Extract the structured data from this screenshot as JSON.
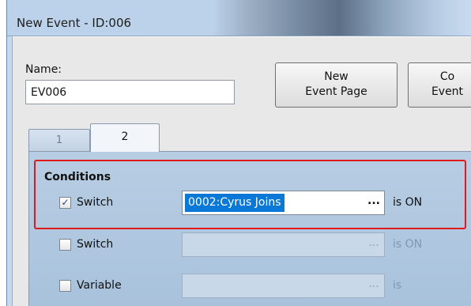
{
  "window": {
    "title": "New Event - ID:006"
  },
  "name": {
    "label": "Name:",
    "value": "EV006"
  },
  "toolbar": {
    "new_page_line1": "New",
    "new_page_line2": "Event Page",
    "copy_page_line1": "Co",
    "copy_page_line2": "Event"
  },
  "tabs": [
    {
      "label": "1",
      "selected": false
    },
    {
      "label": "2",
      "selected": true
    }
  ],
  "conditions": {
    "label": "Conditions",
    "rows": [
      {
        "label": "Switch",
        "checked": true,
        "value": "0002:Cyrus Joins",
        "dots": "...",
        "suffix": "is ON",
        "enabled": true
      },
      {
        "label": "Switch",
        "checked": false,
        "value": "",
        "dots": "...",
        "suffix": "is ON",
        "enabled": false
      },
      {
        "label": "Variable",
        "checked": false,
        "value": "",
        "dots": "...",
        "suffix": "is",
        "enabled": false
      }
    ]
  },
  "colors": {
    "highlight": "#e0191b",
    "selection": "#0a78d7",
    "panel": "#b7cde3"
  },
  "icons": {
    "checkmark": "✓"
  }
}
